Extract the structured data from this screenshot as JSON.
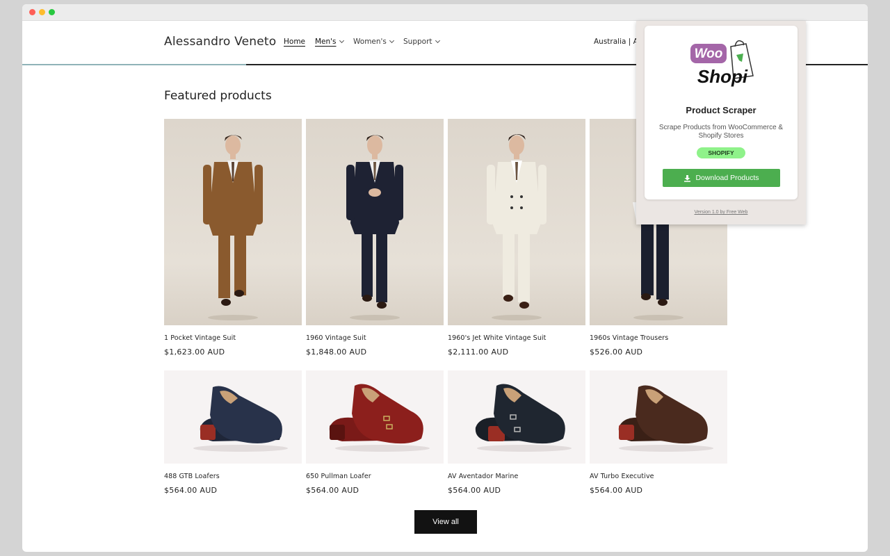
{
  "store": {
    "brand": "Alessandro Veneto",
    "nav": [
      {
        "label": "Home",
        "active": true,
        "dropdown": false
      },
      {
        "label": "Men's",
        "active": true,
        "dropdown": true
      },
      {
        "label": "Women's",
        "active": false,
        "dropdown": true
      },
      {
        "label": "Support",
        "active": false,
        "dropdown": true
      }
    ],
    "locale": "Australia | AU"
  },
  "featured": {
    "title": "Featured products",
    "products": [
      {
        "name": "1 Pocket Vintage Suit",
        "price": "$1,623.00 AUD",
        "kind": "suit",
        "color": "#8a5a2e"
      },
      {
        "name": "1960 Vintage Suit",
        "price": "$1,848.00 AUD",
        "kind": "suit",
        "color": "#1e2233"
      },
      {
        "name": "1960's Jet White Vintage Suit",
        "price": "$2,111.00 AUD",
        "kind": "suit",
        "color": "#efebe0"
      },
      {
        "name": "1960s Vintage Trousers",
        "price": "$526.00 AUD",
        "kind": "suit",
        "color": "#1b1f2e"
      },
      {
        "name": "488 GTB Loafers",
        "price": "$564.00 AUD",
        "kind": "shoe",
        "color": "#28324a"
      },
      {
        "name": "650 Pullman Loafer",
        "price": "$564.00 AUD",
        "kind": "shoe",
        "color": "#8c1f1c"
      },
      {
        "name": "AV Aventador Marine",
        "price": "$564.00 AUD",
        "kind": "shoe",
        "color": "#1f2630"
      },
      {
        "name": "AV Turbo Executive",
        "price": "$564.00 AUD",
        "kind": "shoe",
        "color": "#4a2a1e"
      }
    ],
    "view_all": "View all"
  },
  "extension": {
    "logo_top": "Woo",
    "logo_bottom": "Shopi",
    "title": "Product Scraper",
    "description": "Scrape Products from WooCommerce & Shopify Stores",
    "badge": "SHOPIFY",
    "download": "Download Products",
    "version": "Version 1.0 by Free Web",
    "colors": {
      "accent": "#4cae4f",
      "badge": "#8ff28a",
      "logo": "#a466a8"
    }
  }
}
